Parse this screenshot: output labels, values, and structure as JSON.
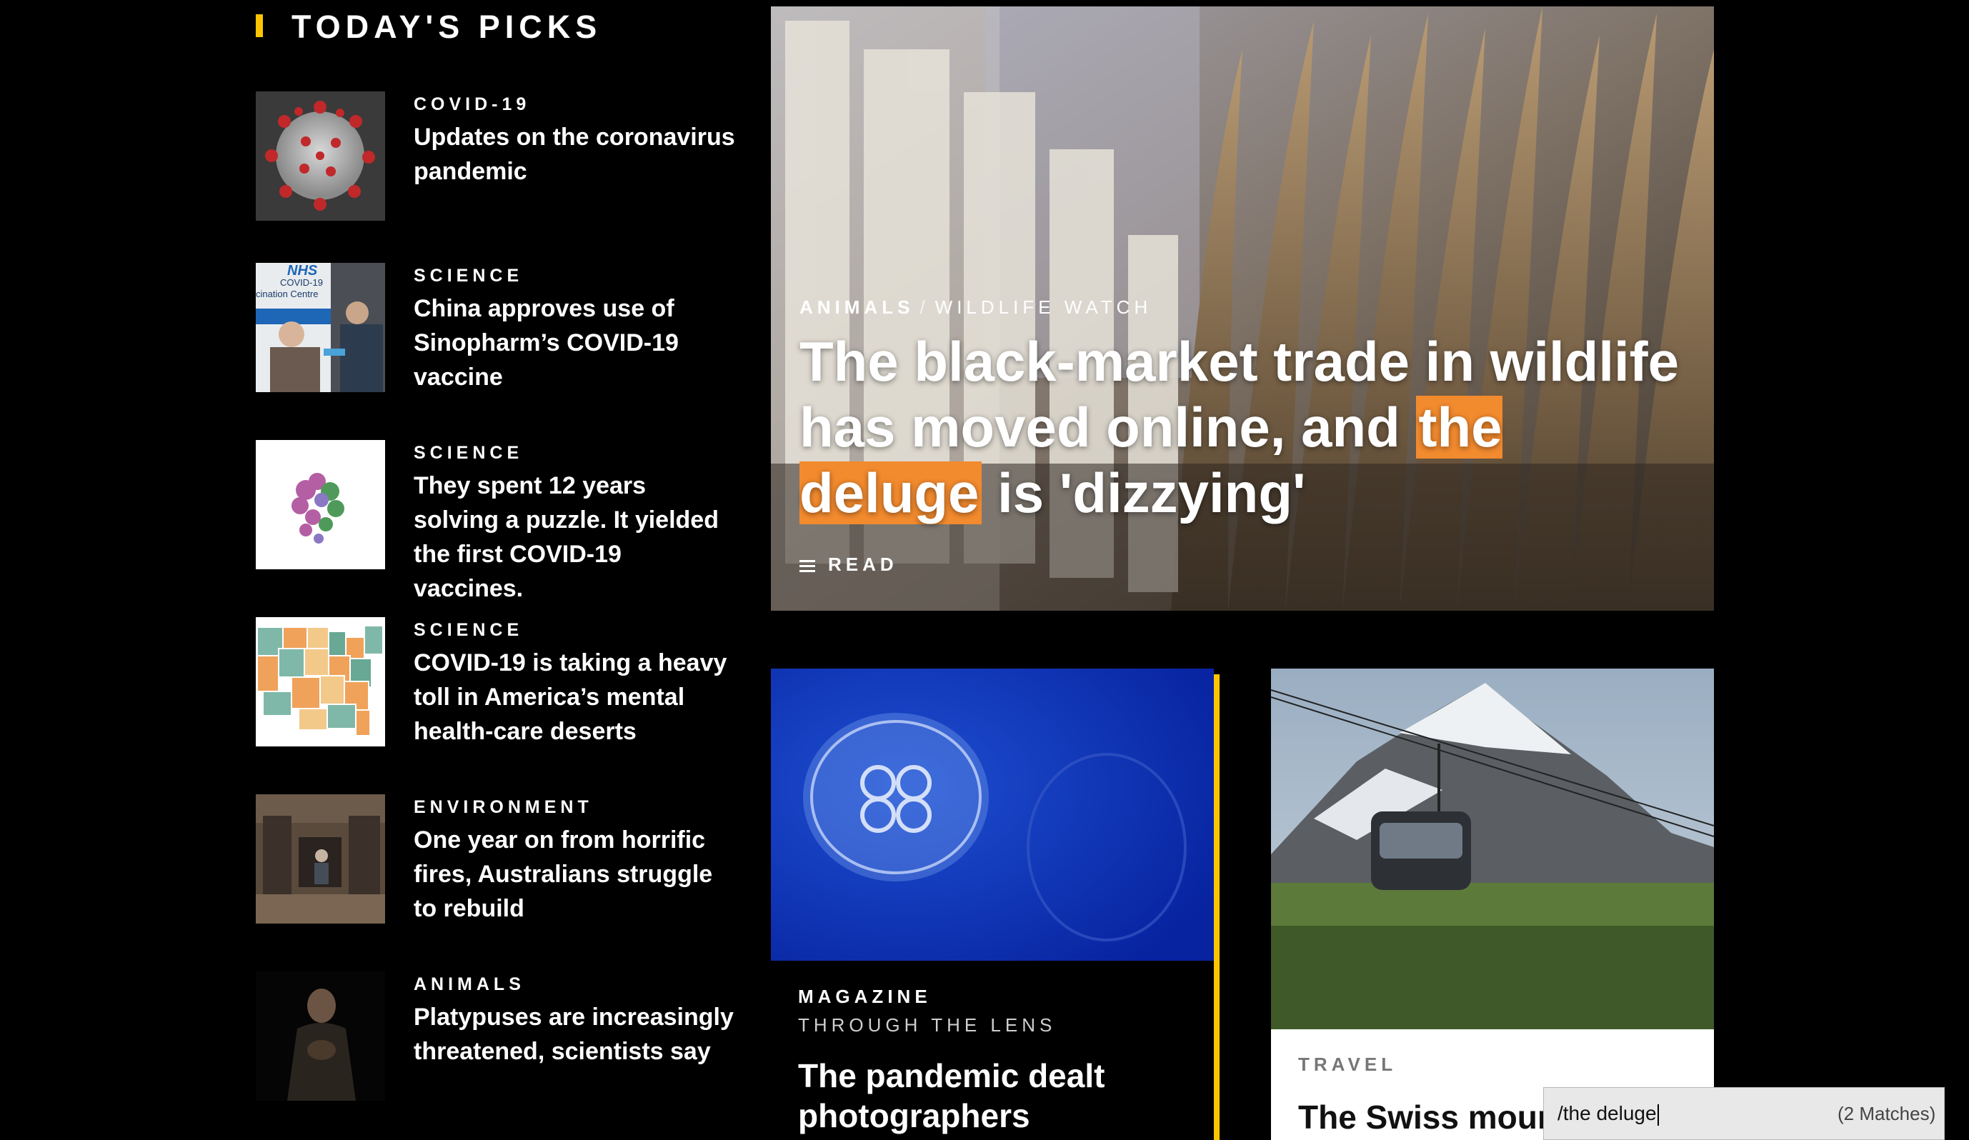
{
  "section": {
    "title": "TODAY'S PICKS"
  },
  "picks": [
    {
      "category": "COVID-19",
      "headline": "Updates on the coronavirus pandemic"
    },
    {
      "category": "SCIENCE",
      "headline": "China approves use of Sinopharm’s COVID-19 vaccine",
      "thumb_text": [
        "NHS",
        "COVID-19",
        "cination Centre"
      ]
    },
    {
      "category": "SCIENCE",
      "headline": "They spent 12 years solving a puzzle. It yielded the first COVID-19 vaccines."
    },
    {
      "category": "SCIENCE",
      "headline": "COVID-19 is taking a heavy toll in America’s mental health-care deserts"
    },
    {
      "category": "ENVIRONMENT",
      "headline": "One year on from horrific fires, Australians struggle to rebuild"
    },
    {
      "category": "ANIMALS",
      "headline": "Platypuses are increasingly threatened, scientists say"
    }
  ],
  "hero": {
    "category": "ANIMALS",
    "separator": "/",
    "subcategory": "WILDLIFE WATCH",
    "title_before": "The black-market trade in wildlife has moved online, and ",
    "title_highlight": "the deluge",
    "title_after": " is 'dizzying'",
    "read_label": "READ"
  },
  "card1": {
    "category": "MAGAZINE",
    "subcategory": "THROUGH THE LENS",
    "title": "The pandemic dealt photographers"
  },
  "card2": {
    "category": "TRAVEL",
    "title": "The Swiss mount"
  },
  "find_bar": {
    "query": "/the deluge",
    "matches": "(2 Matches)"
  },
  "colors": {
    "accent_yellow": "#fdc500",
    "highlight_orange": "#f28a2e",
    "background": "#000000"
  }
}
